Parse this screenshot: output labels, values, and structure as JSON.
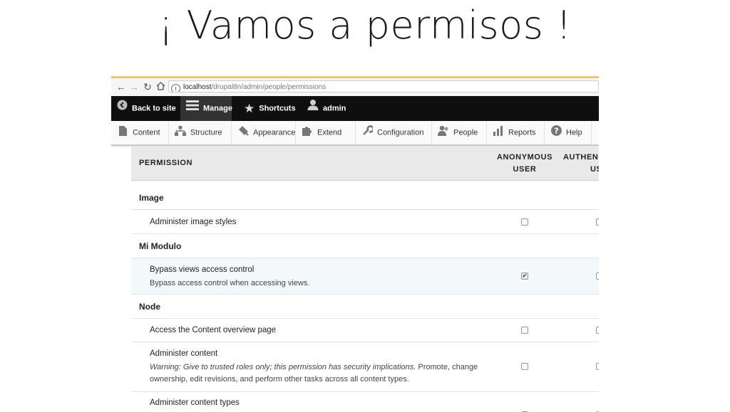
{
  "slide": {
    "title": "¡ Vamos a permisos !"
  },
  "browser": {
    "url_host": "localhost",
    "url_path": "/drupal8n/admin/people/permissions"
  },
  "toolbar": {
    "back_label": "Back to site",
    "manage_label": "Manage",
    "shortcuts_label": "Shortcuts",
    "user_label": "admin"
  },
  "tray": {
    "items": [
      {
        "label": "Content",
        "icon": "file-icon"
      },
      {
        "label": "Structure",
        "icon": "structure-icon"
      },
      {
        "label": "Appearance",
        "icon": "brush-icon"
      },
      {
        "label": "Extend",
        "icon": "puzzle-icon"
      },
      {
        "label": "Configuration",
        "icon": "wrench-icon"
      },
      {
        "label": "People",
        "icon": "people-icon"
      },
      {
        "label": "Reports",
        "icon": "chart-icon"
      },
      {
        "label": "Help",
        "icon": "help-icon"
      }
    ]
  },
  "table": {
    "header": {
      "permission": "PERMISSION",
      "anon_line1": "ANONYMOUS",
      "anon_line2": "USER",
      "auth_line1": "AUTHEN",
      "auth_line2": "US"
    },
    "groups": [
      {
        "module": "Image",
        "perms": [
          {
            "title": "Administer image styles",
            "anon": false,
            "auth": false
          }
        ]
      },
      {
        "module": "Mi Modulo",
        "perms": [
          {
            "title": "Bypass views access control",
            "description": "Bypass access control when accessing views.",
            "anon": true,
            "auth": false
          }
        ]
      },
      {
        "module": "Node",
        "perms": [
          {
            "title": "Access the Content overview page",
            "anon": false,
            "auth": false
          },
          {
            "title": "Administer content",
            "warning": "Warning: Give to trusted roles only; this permission has security implications.",
            "description_line1": " Promote, change",
            "description_line2": "ownership, edit revisions, and perform other tasks across all content types.",
            "anon": false,
            "auth": false
          },
          {
            "title": "Administer content types",
            "anon": false,
            "auth": false
          }
        ]
      }
    ]
  }
}
